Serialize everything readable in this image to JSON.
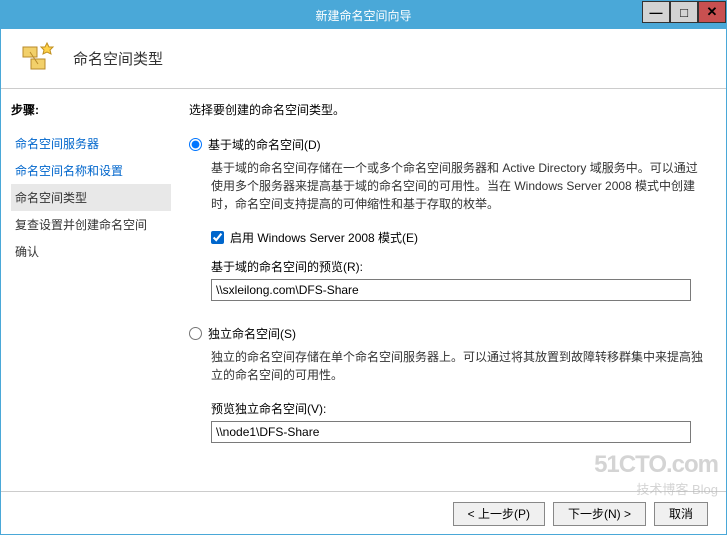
{
  "titlebar": {
    "title": "新建命名空间向导"
  },
  "header": {
    "title": "命名空间类型"
  },
  "sidebar": {
    "steps_label": "步骤:",
    "items": [
      {
        "label": "命名空间服务器"
      },
      {
        "label": "命名空间名称和设置"
      },
      {
        "label": "命名空间类型"
      },
      {
        "label": "复查设置并创建命名空间"
      },
      {
        "label": "确认"
      }
    ]
  },
  "content": {
    "intro": "选择要创建的命名空间类型。",
    "opt1": {
      "label": "基于域的命名空间(D)",
      "desc": "基于域的命名空间存储在一个或多个命名空间服务器和 Active Directory 域服务中。可以通过使用多个服务器来提高基于域的命名空间的可用性。当在 Windows Server 2008 模式中创建时，命名空间支持提高的可伸缩性和基于存取的枚举。",
      "check_label": "启用 Windows Server 2008 模式(E)",
      "preview_label": "基于域的命名空间的预览(R):",
      "preview_value": "\\\\sxleilong.com\\DFS-Share"
    },
    "opt2": {
      "label": "独立命名空间(S)",
      "desc": "独立的命名空间存储在单个命名空间服务器上。可以通过将其放置到故障转移群集中来提高独立的命名空间的可用性。",
      "preview_label": "预览独立命名空间(V):",
      "preview_value": "\\\\node1\\DFS-Share"
    }
  },
  "footer": {
    "prev": "< 上一步(P)",
    "next": "下一步(N) >",
    "cancel": "取消"
  },
  "watermark": {
    "big": "51CTO.com",
    "sm": "技术博客 Blog"
  }
}
